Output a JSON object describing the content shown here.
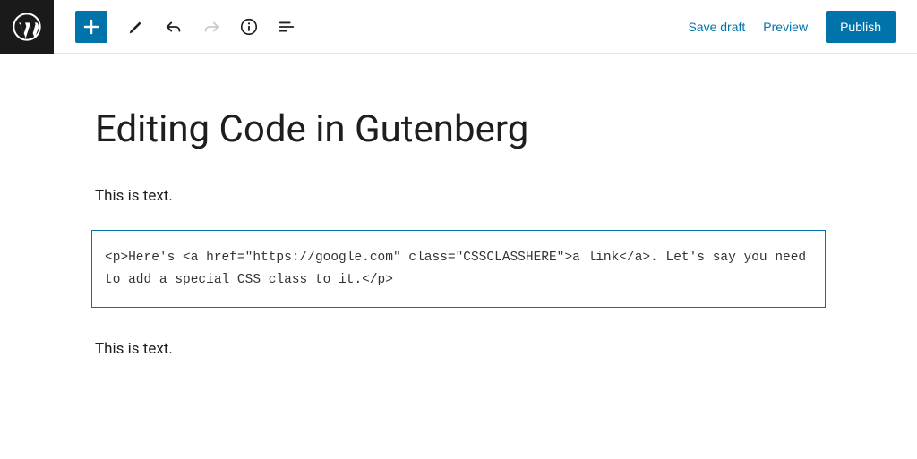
{
  "header": {
    "save_draft": "Save draft",
    "preview": "Preview",
    "publish": "Publish"
  },
  "post": {
    "title": "Editing Code in Gutenberg",
    "blocks": {
      "para1": "This is text.",
      "code": "<p>Here's <a href=\"https://google.com\" class=\"CSSCLASSHERE\">a link</a>. Let's say you need to add a special CSS class to it.</p>",
      "para2": "This is text."
    }
  }
}
